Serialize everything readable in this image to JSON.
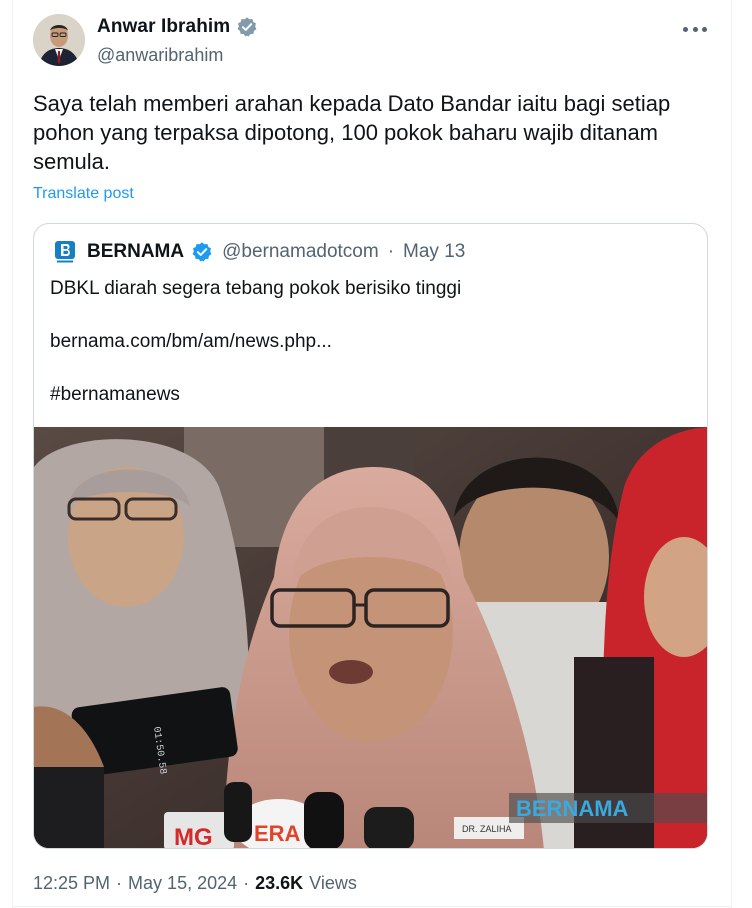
{
  "author": {
    "name": "Anwar Ibrahim",
    "handle": "@anwaribrahim",
    "verified": true
  },
  "tweet": {
    "text": "Saya telah memberi arahan kepada Dato Bandar iaitu bagi setiap pohon yang terpaksa dipotong, 100 pokok baharu wajib ditanam semula.",
    "translate_label": "Translate post"
  },
  "quote": {
    "name": "BERNAMA",
    "handle": "@bernamadotcom",
    "separator": "·",
    "date": "May 13",
    "line1": "DBKL diarah segera tebang pokok berisiko tinggi",
    "link": "bernama.com/bm/am/news.php...",
    "hashtag": "#bernamanews",
    "photo": {
      "watermark": "BERNAMA",
      "badge_name": "DR. ZALIHA",
      "mic_labels": [
        "MG",
        "ERA"
      ],
      "phone_time": "01:50.58"
    }
  },
  "meta": {
    "time": "12:25 PM",
    "dot1": "·",
    "date": "May 15, 2024",
    "dot2": "·",
    "views_count": "23.6K",
    "views_label": "Views"
  },
  "colors": {
    "accent": "#1d9bf0",
    "secondary_text": "#536471",
    "primary_text": "#0f1419",
    "border": "#cfd9de"
  },
  "icons": {
    "verified": "verified-badge-icon",
    "more": "more-options-icon",
    "quote_logo": "bernama-logo-icon"
  }
}
